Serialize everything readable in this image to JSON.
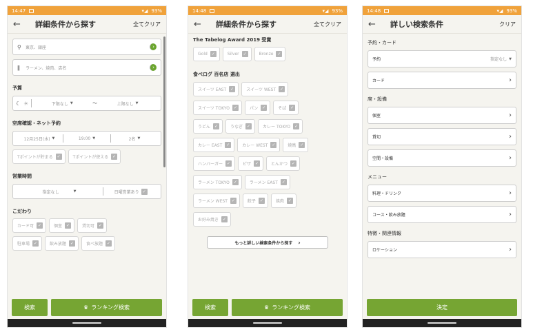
{
  "screen1": {
    "status": {
      "time": "14:47",
      "battery": "93%"
    },
    "title": "詳細条件から探す",
    "clear": "全てクリア",
    "location_placeholder": "東京、銀座",
    "keyword_placeholder": "ラーメン、焼肉、店名",
    "budget_label": "予算",
    "budget_min": "下限なし",
    "budget_max": "上限なし",
    "budget_tilde": "〜",
    "reserve_label": "空席確認・ネット予約",
    "reserve_date": "12月25日(水)",
    "reserve_time": "19:00",
    "reserve_people": "2名",
    "point_earn": "Tポイントが貯まる",
    "point_use": "Tポイントが使える",
    "hours_label": "営業時間",
    "hours_value": "指定なし",
    "hours_open_day": "日曜営業あり",
    "kodawari_label": "こだわり",
    "kodawari_chips": [
      "カード可",
      "個室",
      "貸切可",
      "駐車場",
      "飲み放題",
      "食べ放題"
    ],
    "search_btn": "検索",
    "ranking_btn": "ランキング検索"
  },
  "screen2": {
    "status": {
      "time": "14:48",
      "battery": "93%"
    },
    "title": "詳細条件から探す",
    "clear": "全てクリア",
    "award_title": "The Tabelog Award 2019 受賞",
    "award_chips": [
      "Gold",
      "Silver",
      "Bronze"
    ],
    "hyakumeiten_title": "食べログ 百名店 選出",
    "hyakumeiten_rows": [
      [
        "スイーツ EAST",
        "スイーツ WEST"
      ],
      [
        "スイーツ TOKYO",
        "パン",
        "そば"
      ],
      [
        "うどん",
        "うなぎ",
        "カレー TOKYO"
      ],
      [
        "カレー EAST",
        "カレー WEST",
        "焼鳥"
      ],
      [
        "ハンバーガー",
        "ピザ",
        "とんかつ"
      ],
      [
        "ラーメン TOKYO",
        "ラーメン EAST"
      ],
      [
        "ラーメン WEST",
        "餃子",
        "焼肉"
      ],
      [
        "お好み焼き"
      ]
    ],
    "more_btn": "もっと詳しい検索条件から探す",
    "search_btn": "検索",
    "ranking_btn": "ランキング検索"
  },
  "screen3": {
    "status": {
      "time": "14:48",
      "battery": "93%"
    },
    "title": "詳しい検索条件",
    "clear": "クリア",
    "sec_reserve": "予約・カード",
    "reserve_item": "予約",
    "reserve_value": "指定なし",
    "card_item": "カード",
    "sec_seat": "席・設備",
    "private_room": "個室",
    "kashikiri": "貸切",
    "space": "空間・設備",
    "sec_menu": "メニュー",
    "food_drink": "料理・ドリンク",
    "course": "コース・飲み放題",
    "sec_feature": "特徴・関連情報",
    "location": "ロケーション",
    "decide_btn": "決定"
  }
}
